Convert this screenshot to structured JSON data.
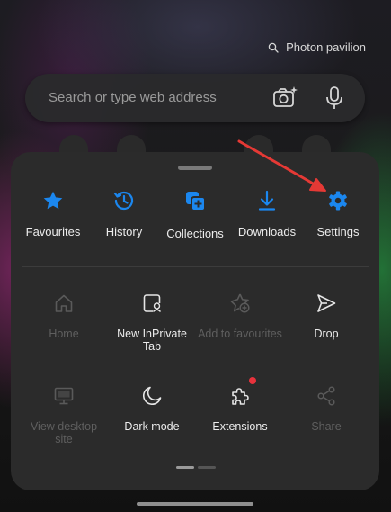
{
  "location": {
    "text": "Photon pavilion",
    "icon": "location-pin-icon"
  },
  "search": {
    "placeholder": "Search or type web address",
    "camera_icon": "visual-search-camera-icon",
    "mic_icon": "microphone-icon"
  },
  "colors": {
    "accent": "#1b87ef",
    "annotation_arrow": "#e53935",
    "badge": "#e8323c",
    "sheet": "#2b2b2b"
  },
  "menu": {
    "top_items": [
      {
        "label": "Favourites",
        "icon": "star-icon"
      },
      {
        "label": "History",
        "icon": "history-clock-icon"
      },
      {
        "label": "Collections",
        "icon": "collections-icon"
      },
      {
        "label": "Downloads",
        "icon": "download-icon"
      },
      {
        "label": "Settings",
        "icon": "gear-icon"
      }
    ],
    "grid_items": [
      {
        "label": "Home",
        "icon": "home-icon",
        "enabled": false
      },
      {
        "label": "New InPrivate Tab",
        "icon": "inprivate-tab-icon",
        "enabled": true
      },
      {
        "label": "Add to favourites",
        "icon": "star-add-icon",
        "enabled": false
      },
      {
        "label": "Drop",
        "icon": "send-drop-icon",
        "enabled": true
      },
      {
        "label": "View desktop site",
        "icon": "desktop-monitor-icon",
        "enabled": false
      },
      {
        "label": "Dark mode",
        "icon": "moon-icon",
        "enabled": true
      },
      {
        "label": "Extensions",
        "icon": "puzzle-icon",
        "enabled": true,
        "badge": true
      },
      {
        "label": "Share",
        "icon": "share-icon",
        "enabled": false
      }
    ],
    "pages": {
      "count": 2,
      "current": 1
    }
  }
}
